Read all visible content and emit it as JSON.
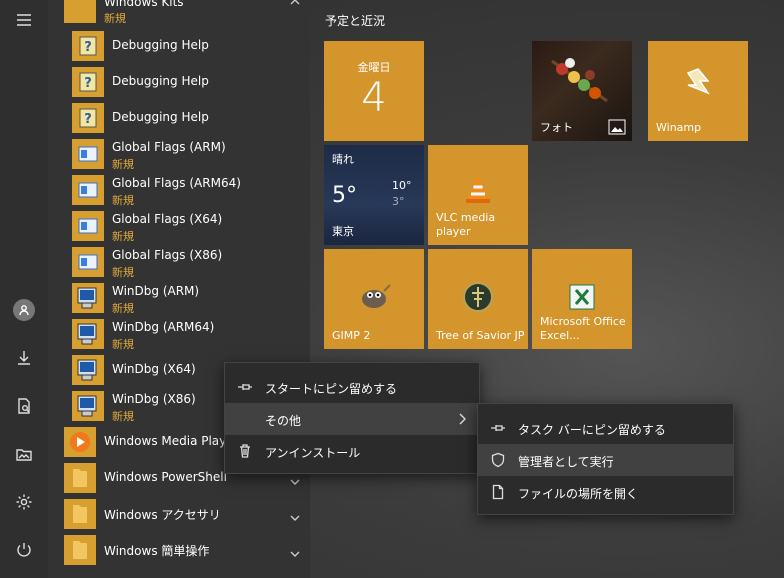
{
  "app_list": [
    {
      "name": "Windows Kits",
      "badge": "新規",
      "kind": "folder"
    },
    {
      "name": "Debugging Help",
      "badge": "",
      "icon": "help-icon"
    },
    {
      "name": "Debugging Help",
      "badge": "",
      "icon": "help-icon"
    },
    {
      "name": "Debugging Help",
      "badge": "",
      "icon": "help-icon"
    },
    {
      "name": "Global Flags (ARM)",
      "badge": "新規",
      "icon": "flags-icon"
    },
    {
      "name": "Global Flags (ARM64)",
      "badge": "新規",
      "icon": "flags-icon"
    },
    {
      "name": "Global Flags (X64)",
      "badge": "新規",
      "icon": "flags-icon"
    },
    {
      "name": "Global Flags (X86)",
      "badge": "新規",
      "icon": "flags-icon"
    },
    {
      "name": "WinDbg (ARM)",
      "badge": "新規",
      "icon": "windbg-icon"
    },
    {
      "name": "WinDbg (ARM64)",
      "badge": "新規",
      "icon": "windbg-icon"
    },
    {
      "name": "WinDbg (X64)",
      "badge": "",
      "icon": "windbg-icon"
    },
    {
      "name": "WinDbg (X86)",
      "badge": "新規",
      "icon": "windbg-icon"
    },
    {
      "name": "Windows Media Player",
      "badge": "",
      "icon": "media-player-icon"
    },
    {
      "name": "Windows PowerShell",
      "badge": "",
      "kind": "folder"
    },
    {
      "name": "Windows アクセサリ",
      "badge": "",
      "kind": "folder"
    },
    {
      "name": "Windows 簡単操作",
      "badge": "",
      "kind": "folder"
    }
  ],
  "tiles": {
    "group_title": "予定と近況",
    "calendar": {
      "day": "金曜日",
      "date": "4"
    },
    "photos": {
      "label": "フォト"
    },
    "winamp": {
      "label": "Winamp"
    },
    "weather": {
      "condition": "晴れ",
      "temp": "5°",
      "high": "10°",
      "low": "3°",
      "city": "東京"
    },
    "vlc": {
      "label": "VLC media player"
    },
    "gimp": {
      "label": "GIMP 2"
    },
    "tos": {
      "label": "Tree of Savior JP"
    },
    "excel": {
      "label": "Microsoft Office Excel..."
    }
  },
  "context_menu": [
    {
      "label": "スタートにピン留めする",
      "icon": "pin-icon"
    },
    {
      "label": "その他",
      "icon": "",
      "submenu": true
    },
    {
      "label": "アンインストール",
      "icon": "trash-icon"
    }
  ],
  "submenu": [
    {
      "label": "タスク バーにピン留めする",
      "icon": "pin-icon"
    },
    {
      "label": "管理者として実行",
      "icon": "shield-icon"
    },
    {
      "label": "ファイルの場所を開く",
      "icon": "file-icon"
    }
  ],
  "colors": {
    "accent": "#d3952c",
    "new_badge": "#e0a83a"
  }
}
